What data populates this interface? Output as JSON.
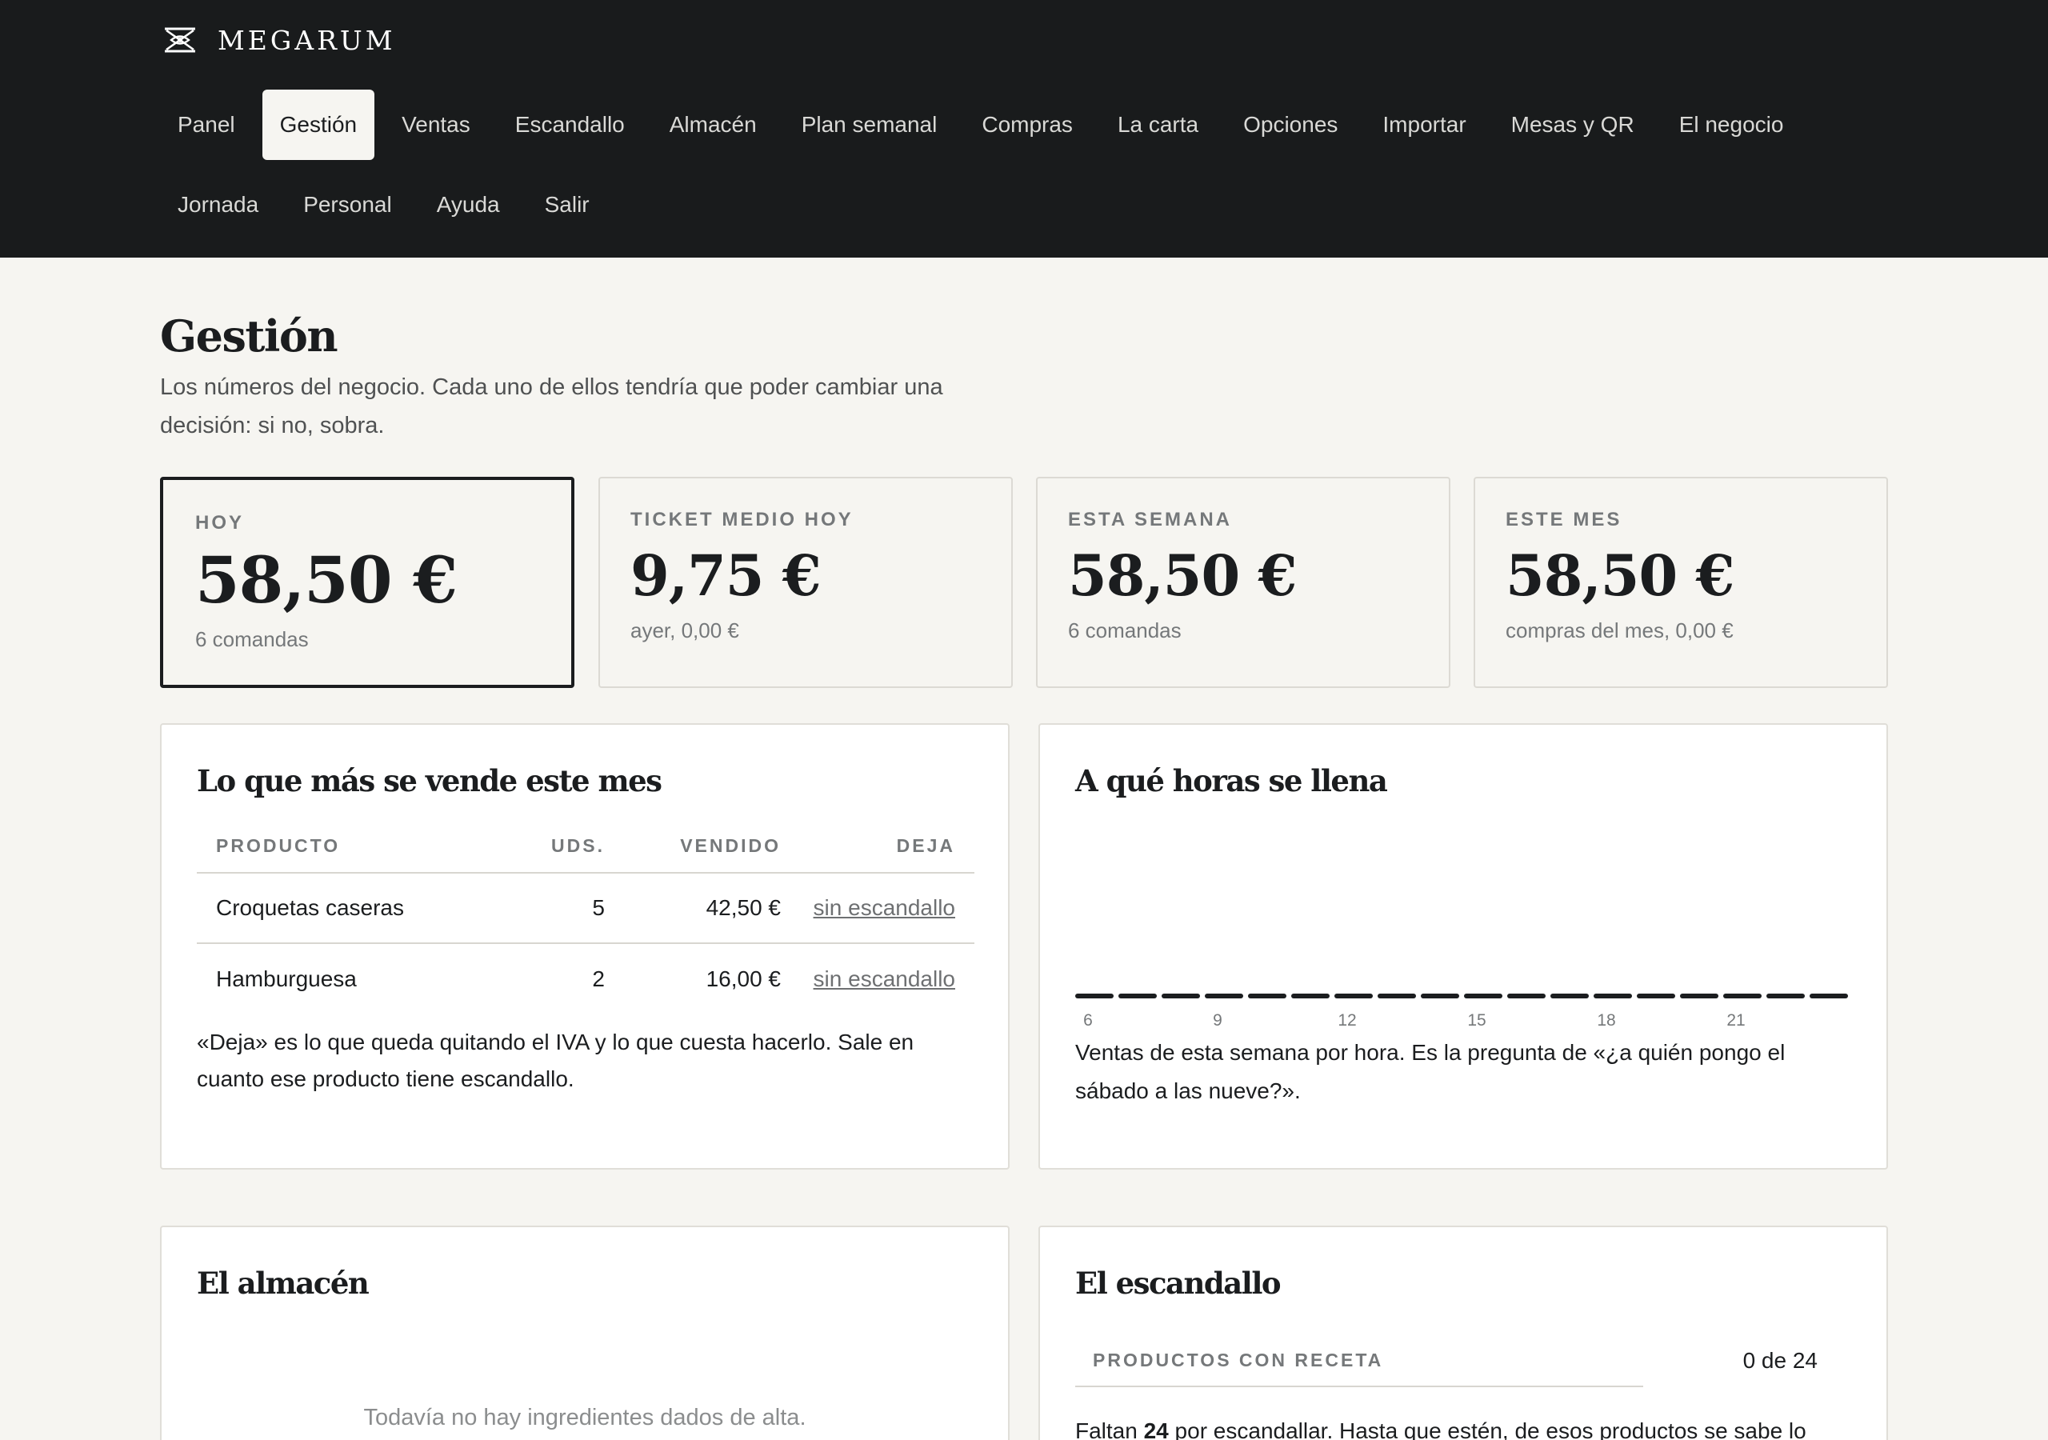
{
  "brand": {
    "name": "MEGARUM",
    "logo_icon": "megarum-logo-icon"
  },
  "nav": {
    "row1": [
      "Panel",
      "Gestión",
      "Ventas",
      "Escandallo",
      "Almacén",
      "Plan semanal",
      "Compras",
      "La carta",
      "Opciones",
      "Importar",
      "Mesas y QR",
      "El negocio"
    ],
    "row2": [
      "Jornada",
      "Personal",
      "Ayuda",
      "Salir"
    ],
    "active": "Gestión"
  },
  "page": {
    "title": "Gestión",
    "subtitle": "Los números del negocio. Cada uno de ellos tendría que poder cambiar una decisión: si no, sobra."
  },
  "kpis": [
    {
      "label": "HOY",
      "value": "58,50 €",
      "sub": "6 comandas"
    },
    {
      "label": "TICKET MEDIO HOY",
      "value": "9,75 €",
      "sub": "ayer, 0,00 €"
    },
    {
      "label": "ESTA SEMANA",
      "value": "58,50 €",
      "sub": "6 comandas"
    },
    {
      "label": "ESTE MES",
      "value": "58,50 €",
      "sub": "compras del mes, 0,00 €"
    }
  ],
  "top_sellers": {
    "title": "Lo que más se vende este mes",
    "columns": [
      "PRODUCTO",
      "UDS.",
      "VENDIDO",
      "DEJA"
    ],
    "rows": [
      {
        "product": "Croquetas caseras",
        "units": "5",
        "sold": "42,50 €",
        "margin": "sin escandallo"
      },
      {
        "product": "Hamburguesa",
        "units": "2",
        "sold": "16,00 €",
        "margin": "sin escandallo"
      }
    ],
    "note": "«Deja» es lo que queda quitando el IVA y lo que cuesta hacerlo. Sale en cuanto ese producto tiene escandallo."
  },
  "hours": {
    "title": "A qué horas se llena",
    "note": "Ventas de esta semana por hora. Es la pregunta de «¿a quién pongo el sábado a las nueve?».",
    "colors": {
      "bar": "#1b1d1f",
      "tick": "#75787a"
    }
  },
  "chart_data": {
    "type": "bar",
    "categories": [
      "6",
      "7",
      "8",
      "9",
      "10",
      "11",
      "12",
      "13",
      "14",
      "15",
      "16",
      "17",
      "18",
      "19",
      "20",
      "21",
      "22",
      "23"
    ],
    "x_tick_labels": [
      "6",
      "9",
      "12",
      "15",
      "18",
      "21"
    ],
    "values": [
      0,
      0,
      0,
      0,
      0,
      0,
      0,
      0,
      0,
      0,
      0,
      0,
      0,
      0,
      0,
      0,
      0,
      0
    ],
    "title": "A qué horas se llena",
    "xlabel": "",
    "ylabel": "",
    "grid": false
  },
  "almacen": {
    "title": "El almacén",
    "empty_text": "Todavía no hay ingredientes dados de alta."
  },
  "escandallo": {
    "title": "El escandallo",
    "label": "PRODUCTOS CON RECETA",
    "value": "0 de 24",
    "note_prefix": "Faltan ",
    "note_count": "24",
    "note_suffix": " por escandallar. Hasta que estén, de esos productos se sabe lo"
  }
}
